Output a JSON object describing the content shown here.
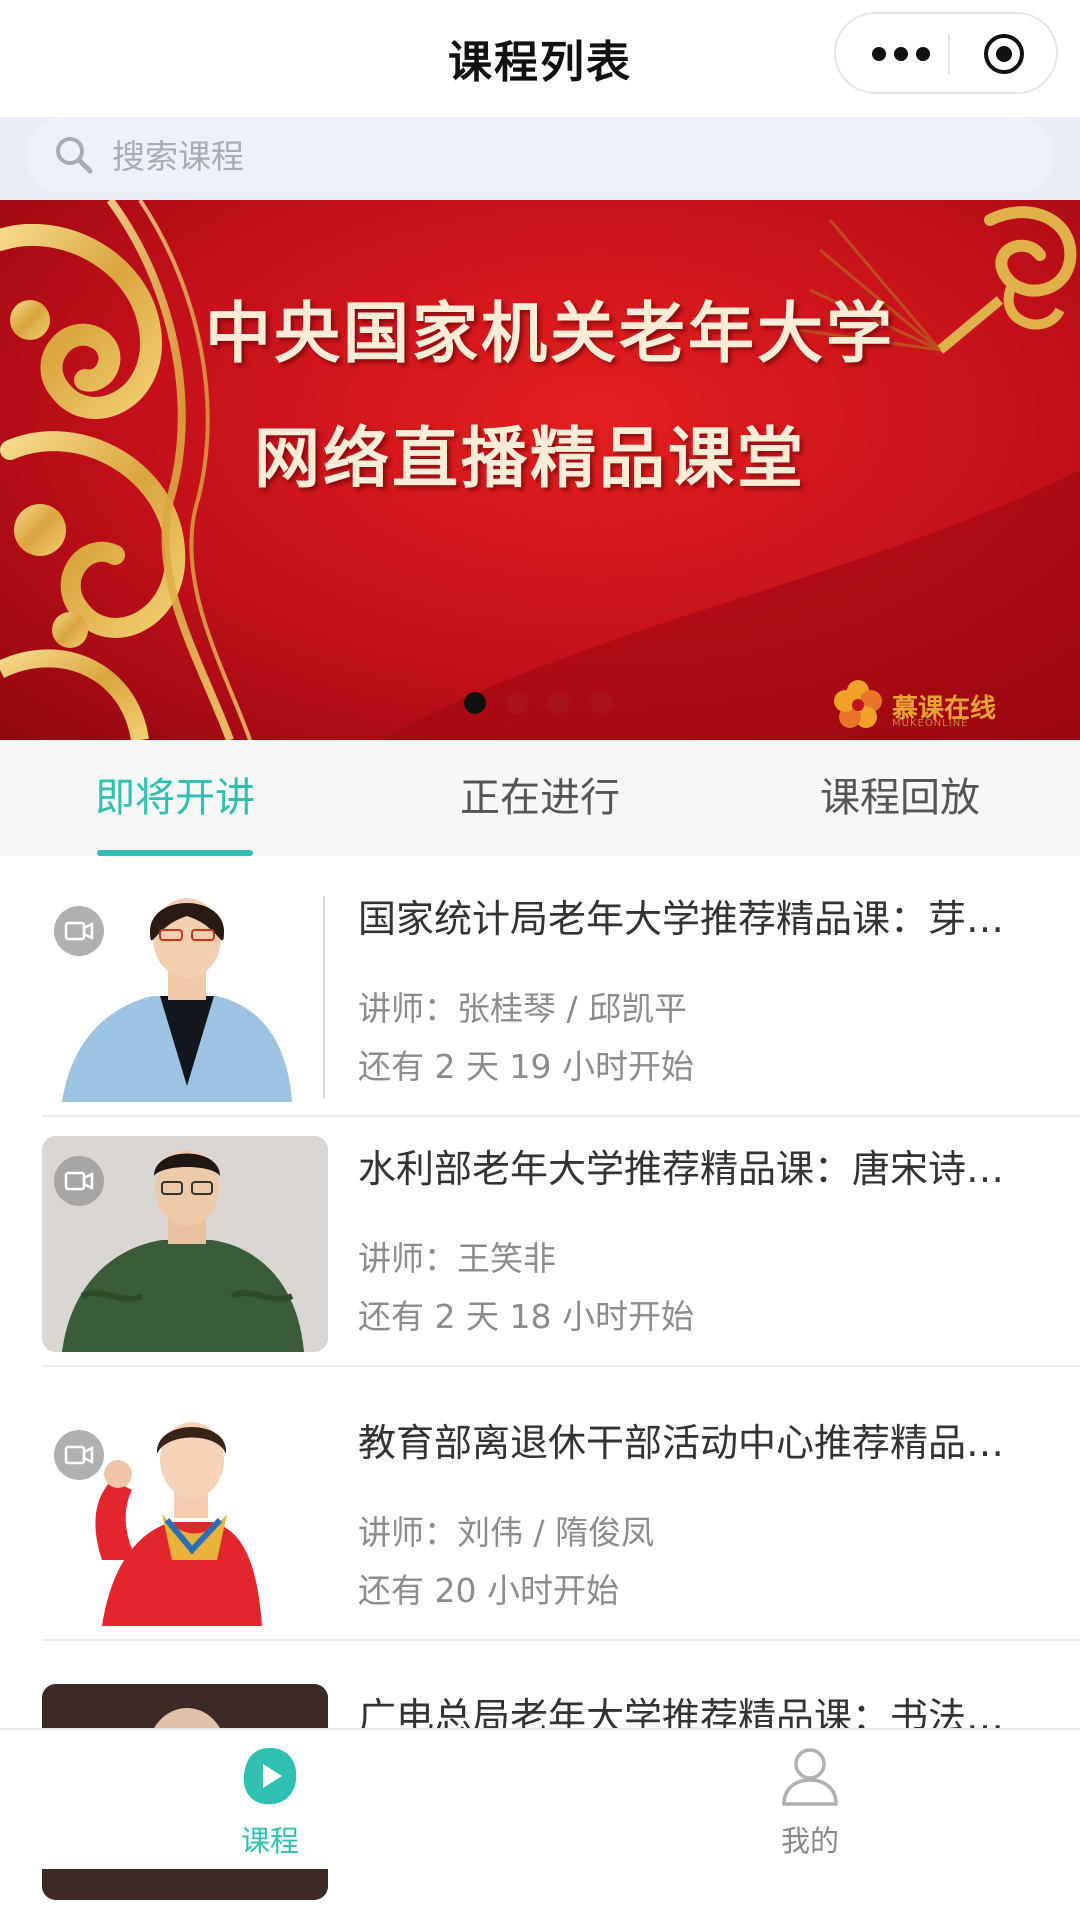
{
  "navbar": {
    "title": "课程列表"
  },
  "search": {
    "placeholder": "搜索课程"
  },
  "banner": {
    "line1": "中央国家机关老年大学",
    "line2": "网络直播精品课堂",
    "logo_text": "慕课在线",
    "logo_subtext": "MUKEONLINE",
    "slide_count": 4,
    "active_slide": 1
  },
  "tabs": [
    {
      "label": "即将开讲",
      "active": true
    },
    {
      "label": "正在进行",
      "active": false
    },
    {
      "label": "课程回放",
      "active": false
    }
  ],
  "courses": [
    {
      "title": "国家统计局老年大学推荐精品课：芽…",
      "teacher": "讲师：张桂琴 / 邱凯平",
      "countdown": "还有 2 天 19 小时开始"
    },
    {
      "title": "水利部老年大学推荐精品课：唐宋诗…",
      "teacher": "讲师：王笑非",
      "countdown": "还有 2 天 18 小时开始"
    },
    {
      "title": "教育部离退休干部活动中心推荐精品…",
      "teacher": "讲师：刘伟 / 隋俊凤",
      "countdown": "还有 20 小时开始"
    },
    {
      "title": "广电总局老年大学推荐精品课：书法…",
      "teacher": "",
      "countdown": ""
    }
  ],
  "tabbar": [
    {
      "label": "课程",
      "icon": "course-play-icon",
      "active": true
    },
    {
      "label": "我的",
      "icon": "profile-icon",
      "active": false
    }
  ],
  "colors": {
    "accent": "#2fc0b1",
    "banner_red": "#c4101a",
    "gold": "#e0b04a",
    "muted_text": "#8c8c8c"
  }
}
